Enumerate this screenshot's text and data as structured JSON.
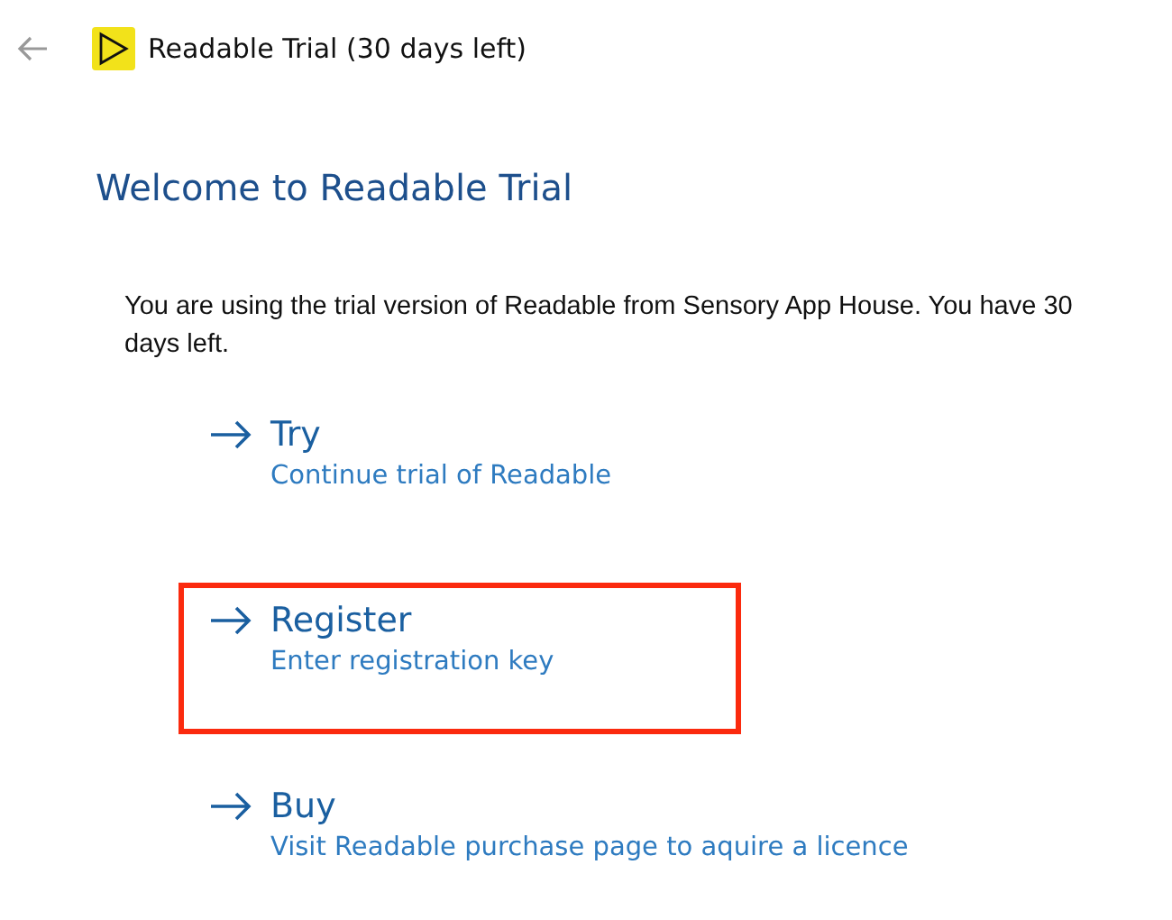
{
  "window": {
    "title": "Readable Trial (30 days left)"
  },
  "heading": "Welcome to Readable Trial",
  "message": "You are using the trial version of Readable from Sensory App House. You have 30 days left.",
  "options": [
    {
      "title": "Try",
      "description": "Continue trial of Readable",
      "highlighted": false
    },
    {
      "title": "Register",
      "description": "Enter registration key",
      "highlighted": true
    },
    {
      "title": "Buy",
      "description": "Visit Readable purchase page to aquire a licence",
      "highlighted": false
    }
  ]
}
